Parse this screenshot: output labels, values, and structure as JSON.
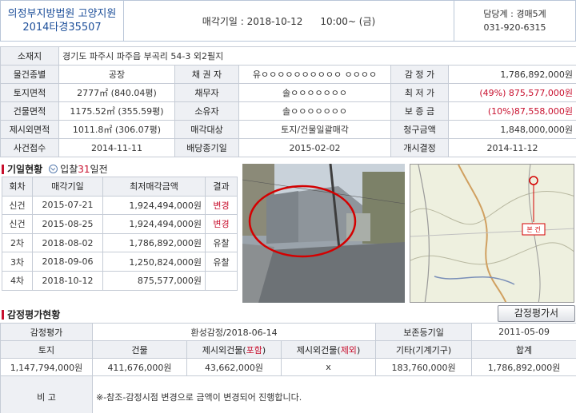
{
  "header": {
    "court": "의정부지방법원 고양지원",
    "case_no": "2014타경35507",
    "date_label": "매각기일 : 2018-10-12",
    "time_label": "10:00~ (금)",
    "dept_label": "담당계 : 경매5계",
    "phone": "031-920-6315"
  },
  "info": {
    "address_label": "소재지",
    "address": "경기도 파주시 파주읍 부곡리 54-3 외2필지",
    "type_label": "물건종별",
    "type": "공장",
    "creditor_label": "채 권 자",
    "creditor": "유ㅇㅇㅇㅇㅇㅇㅇㅇㅇㅇ ㅇㅇㅇㅇ",
    "appraisal_label": "감 정 가",
    "appraisal": "1,786,892,000원",
    "land_label": "토지면적",
    "land": "2777㎡ (840.04평)",
    "debtor_label": "채무자",
    "debtor": "솔ㅇㅇㅇㅇㅇㅇㅇ",
    "min_label": "최 저 가",
    "min": "(49%) 875,577,000원",
    "bldg_label": "건물면적",
    "bldg": "1175.52㎡ (355.59평)",
    "owner_label": "소유자",
    "owner": "솔ㅇㅇㅇㅇㅇㅇㅇ",
    "deposit_label": "보 증 금",
    "deposit": "(10%)87,558,000원",
    "excl_label": "제시외면적",
    "excl": "1011.8㎡ (306.07평)",
    "target_label": "매각대상",
    "target": "토지/건물일괄매각",
    "claim_label": "청구금액",
    "claim": "1,848,000,000원",
    "receipt_label": "사건접수",
    "receipt": "2014-11-11",
    "dividend_label": "배당종기일",
    "dividend": "2015-02-02",
    "start_label": "개시결정",
    "start": "2014-11-12"
  },
  "history": {
    "title": "기일현황",
    "dday_prefix": "입찰",
    "dday_num": "31",
    "dday_suffix": "일전",
    "headers": [
      "회차",
      "매각기일",
      "최저매각금액",
      "결과"
    ],
    "rows": [
      {
        "round": "신건",
        "date": "2015-07-21",
        "price": "1,924,494,000원",
        "result": "변경"
      },
      {
        "round": "신건",
        "date": "2015-08-25",
        "price": "1,924,494,000원",
        "result": "변경"
      },
      {
        "round": "2차",
        "date": "2018-08-02",
        "price": "1,786,892,000원",
        "result": "유찰"
      },
      {
        "round": "3차",
        "date": "2018-09-06",
        "price": "1,250,824,000원",
        "result": "유찰"
      },
      {
        "round": "4차",
        "date": "2018-10-12",
        "price": "875,577,000원",
        "result": ""
      }
    ]
  },
  "map_label": "본 건",
  "appraisal_section": {
    "title": "감정평가현황",
    "button": "감정평가서",
    "row1": {
      "label": "감정평가",
      "agency": "환성감정/2018-06-14",
      "reg_label": "보존등기일",
      "reg_date": "2011-05-09"
    },
    "headers": {
      "land": "토지",
      "bldg": "건물",
      "incl_pre": "제시외건물(",
      "incl_red": "포함",
      "incl_post": ")",
      "excl_pre": "제시외건물(",
      "excl_red": "제외",
      "excl_post": ")",
      "etc": "기타(기계기구)",
      "total": "합계"
    },
    "values": {
      "land": "1,147,794,000원",
      "bldg": "411,676,000원",
      "incl": "43,662,000원",
      "excl": "x",
      "etc": "183,760,000원",
      "total": "1,786,892,000원"
    },
    "note_label": "비 고",
    "note": "※-참조-감정시점 변경으로 금액이 변경되어 진행합니다."
  }
}
